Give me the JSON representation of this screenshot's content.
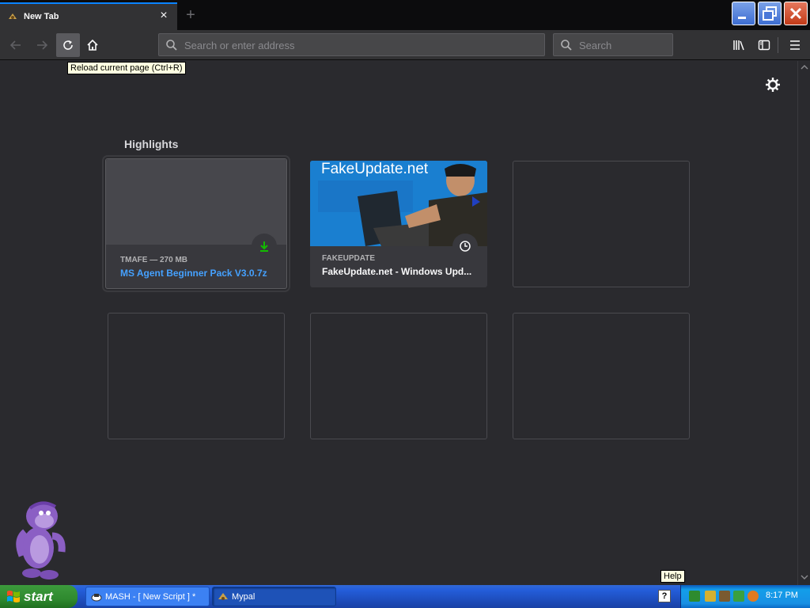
{
  "browser": {
    "tab": {
      "title": "New Tab",
      "close_glyph": "×"
    },
    "new_tab_glyph": "+",
    "urlbar": {
      "placeholder": "Search or enter address"
    },
    "searchbar": {
      "placeholder": "Search"
    },
    "tooltip": "Reload current page (Ctrl+R)",
    "icons": [
      "back-arrow-icon",
      "forward-arrow-icon",
      "reload-icon",
      "home-icon",
      "search-icon",
      "library-icon",
      "sidebar-icon",
      "hamburger-menu-icon",
      "gear-icon"
    ]
  },
  "newtab": {
    "section_title": "Highlights",
    "cards": [
      {
        "meta": "TMAFE — 270 MB",
        "title": "MS Agent Beginner Pack V3.0.7z",
        "title_color": "#45a1ff",
        "badge": "download-icon"
      },
      {
        "meta": "FAKEUPDATE",
        "title": "FakeUpdate.net - Windows Upd...",
        "title_color": "#f9f9fa",
        "badge": "clock-icon",
        "thumb_text": "FakeUpdate.net"
      }
    ]
  },
  "taskbar": {
    "start_label": "start",
    "tasks": [
      {
        "label": "MASH - [ New Script ] *"
      },
      {
        "label": "Mypal"
      }
    ],
    "help_tip": "Help",
    "help_icon": "?",
    "clock": "8:17 PM"
  },
  "colors": {
    "accent": "#0a84ff",
    "download_green": "#12bc00",
    "link_blue": "#45a1ff"
  }
}
